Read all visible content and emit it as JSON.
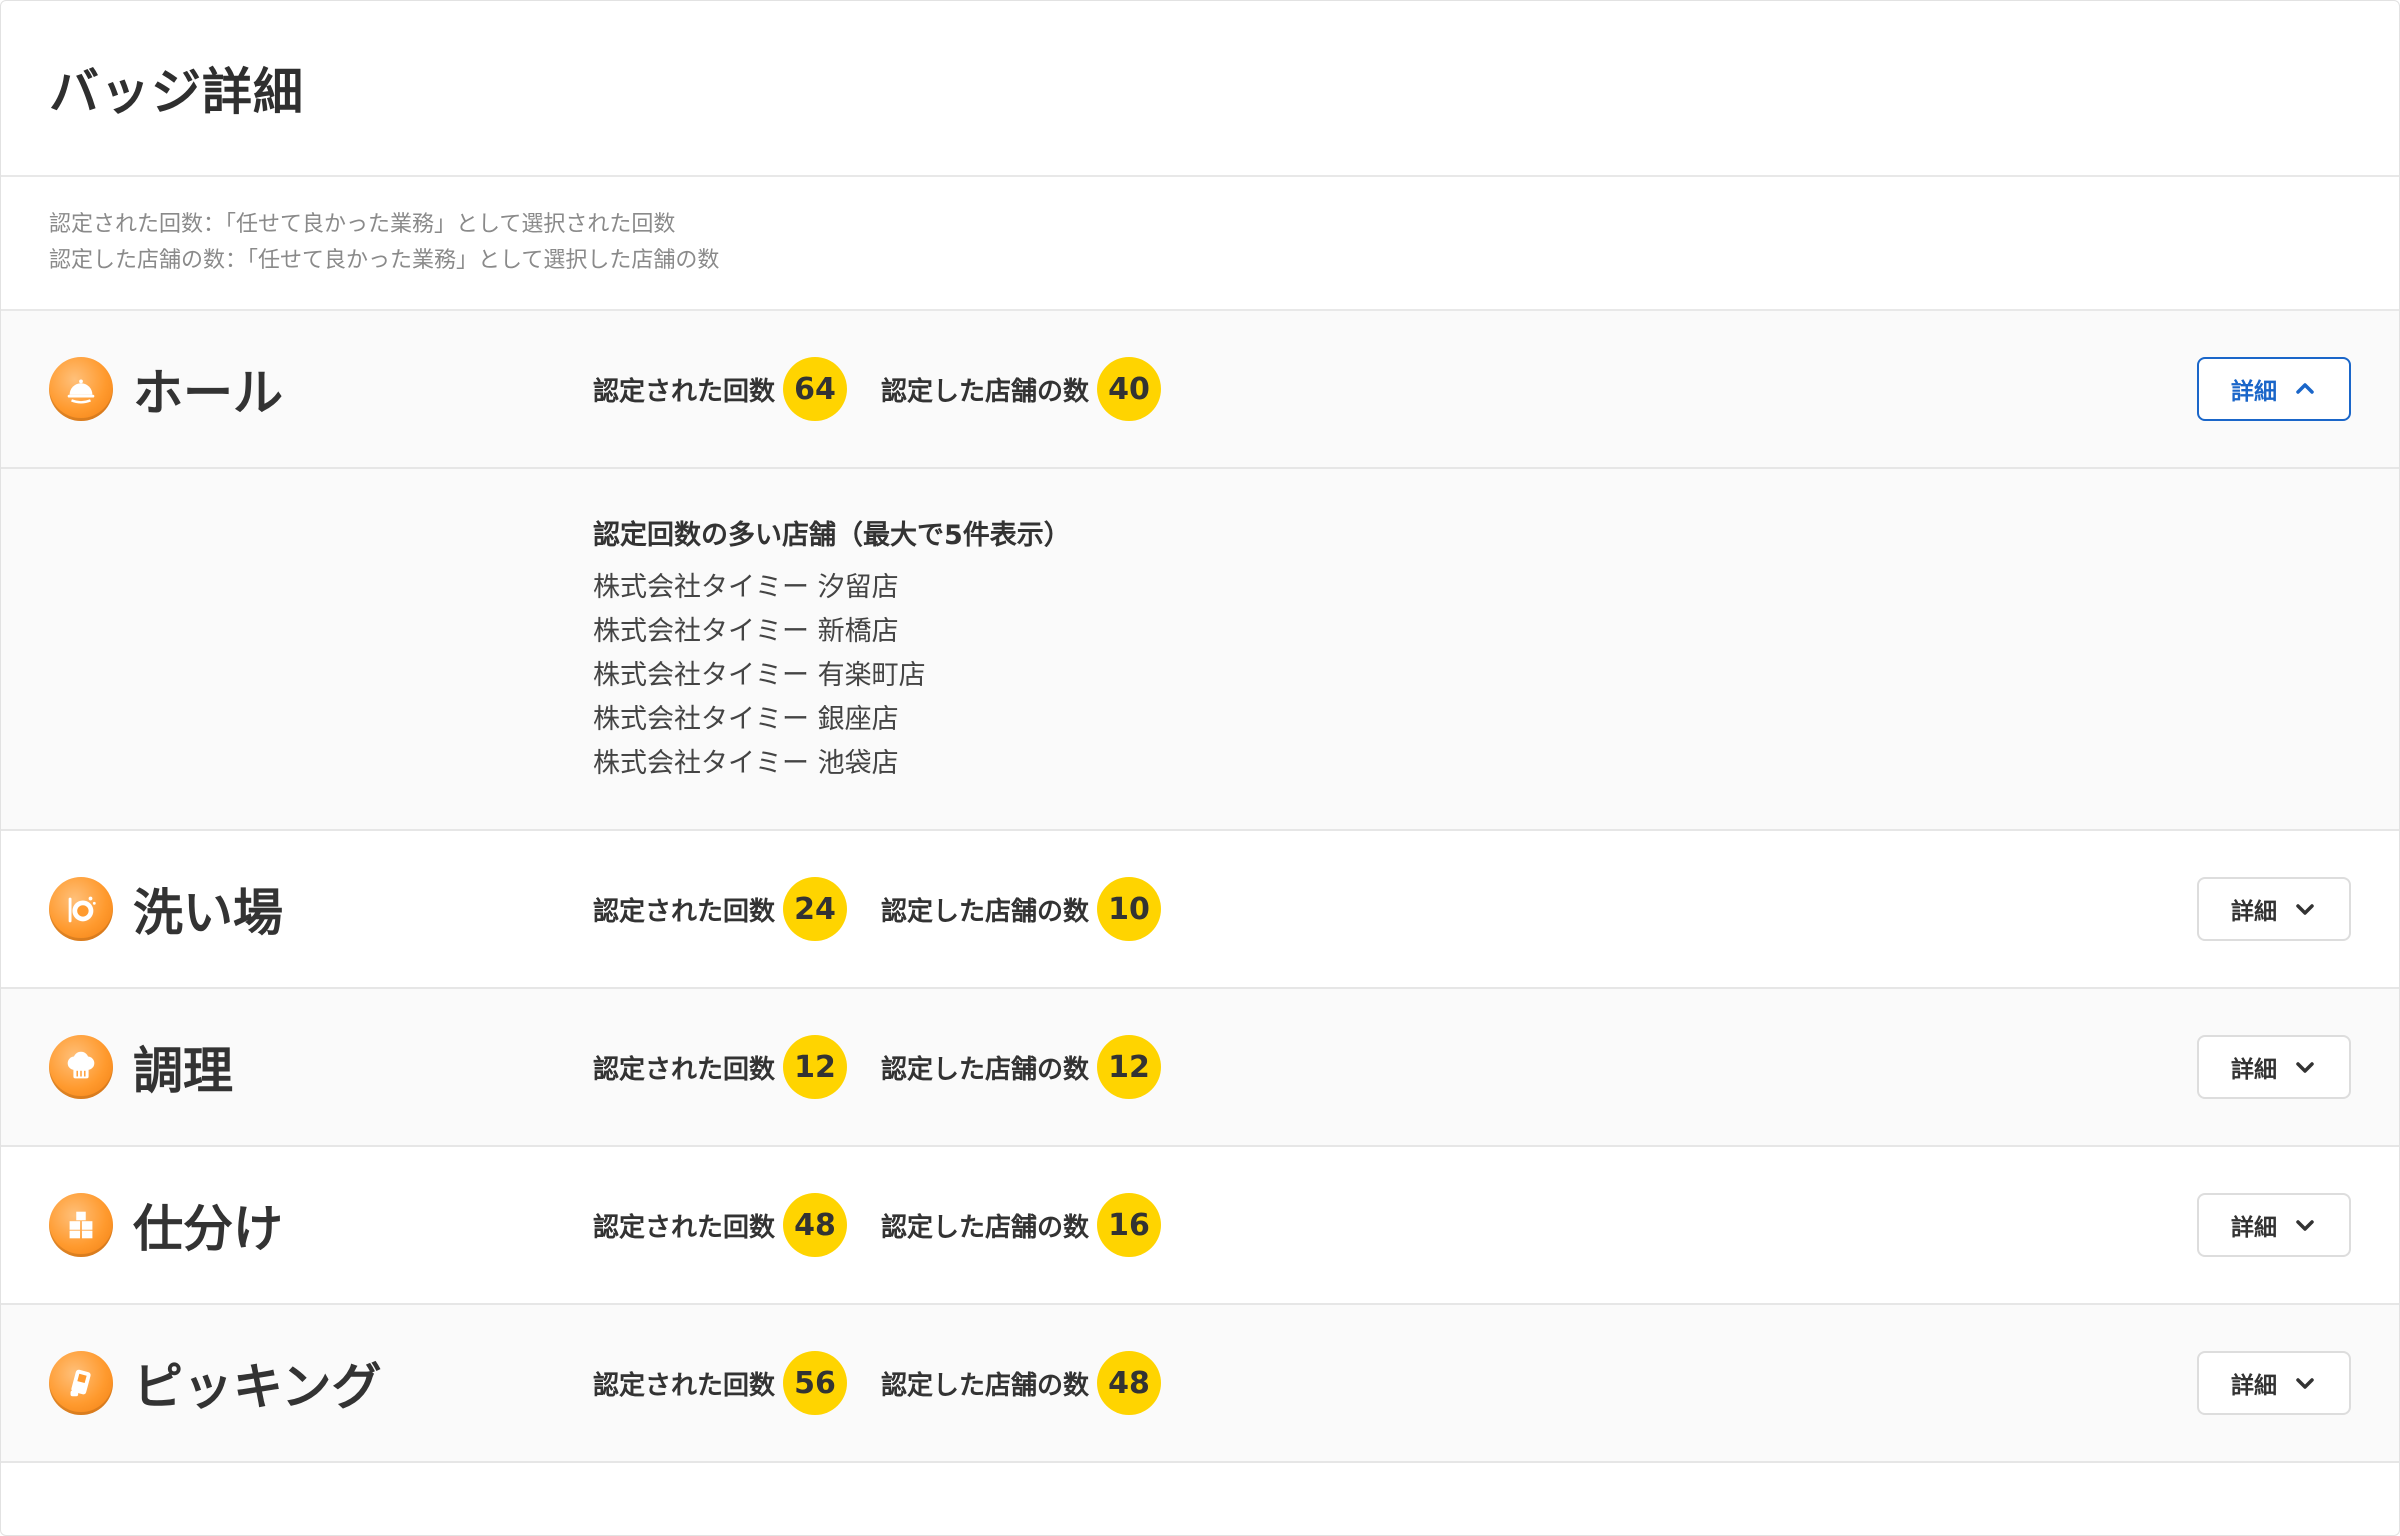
{
  "header": {
    "title": "バッジ詳細"
  },
  "notes": [
    "認定された回数：「任せて良かった業務」として選択された回数",
    "認定した店舗の数：「任せて良かった業務」として選択した店舗の数"
  ],
  "labels": {
    "times": "認定された回数",
    "stores": "認定した店舗の数",
    "detail": "詳細"
  },
  "categories": [
    {
      "name": "ホール",
      "icon": "serving-cloche-icon",
      "times": "64",
      "stores": "40",
      "expanded": true
    },
    {
      "name": "洗い場",
      "icon": "dishwashing-icon",
      "times": "24",
      "stores": "10",
      "expanded": false
    },
    {
      "name": "調理",
      "icon": "chef-hat-icon",
      "times": "12",
      "stores": "12",
      "expanded": false
    },
    {
      "name": "仕分け",
      "icon": "boxes-icon",
      "times": "48",
      "stores": "16",
      "expanded": false
    },
    {
      "name": "ピッキング",
      "icon": "scanner-icon",
      "times": "56",
      "stores": "48",
      "expanded": false
    }
  ],
  "expanded_panel": {
    "title": "認定回数の多い店舗（最大で5件表示）",
    "stores": [
      "株式会社タイミー 汐留店",
      "株式会社タイミー 新橋店",
      "株式会社タイミー 有楽町店",
      "株式会社タイミー 銀座店",
      "株式会社タイミー 池袋店"
    ]
  },
  "colors": {
    "accent": "#1a66c9",
    "count_badge": "#ffd400",
    "icon_orange": "#ff9a2e"
  }
}
